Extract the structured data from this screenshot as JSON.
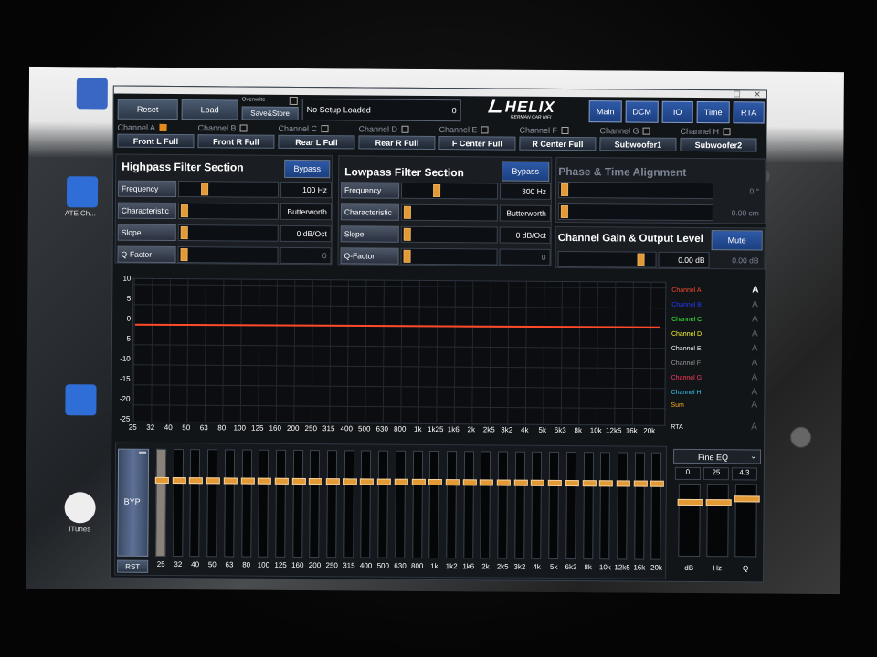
{
  "toolbar": {
    "reset_label": "Reset",
    "load_label": "Load",
    "overwrite_label": "Overwrite",
    "save_label": "Save&Store",
    "setup_status": "No Setup Loaded",
    "setup_count": "0",
    "brand": "HELIX",
    "brand_sub": "GERMAN CAR HIFI",
    "tabs": [
      "Main",
      "DCM",
      "IO",
      "Time",
      "RTA"
    ]
  },
  "channels": [
    {
      "name": "Channel A",
      "assign": "Front L Full",
      "checked": true
    },
    {
      "name": "Channel B",
      "assign": "Front R Full",
      "checked": false
    },
    {
      "name": "Channel C",
      "assign": "Rear L Full",
      "checked": false
    },
    {
      "name": "Channel D",
      "assign": "Rear R Full",
      "checked": false
    },
    {
      "name": "Channel E",
      "assign": "F Center Full",
      "checked": false
    },
    {
      "name": "Channel F",
      "assign": "R Center Full",
      "checked": false
    },
    {
      "name": "Channel G",
      "assign": "Subwoofer1",
      "checked": false
    },
    {
      "name": "Channel H",
      "assign": "Subwoofer2",
      "checked": false
    }
  ],
  "highpass": {
    "title": "Highpass Filter Section",
    "bypass_label": "Bypass",
    "rows": [
      {
        "label": "Frequency",
        "value": "100 Hz"
      },
      {
        "label": "Characteristic",
        "value": "Butterworth"
      },
      {
        "label": "Slope",
        "value": "0 dB/Oct"
      },
      {
        "label": "Q-Factor",
        "value": "0"
      }
    ]
  },
  "lowpass": {
    "title": "Lowpass Filter Section",
    "bypass_label": "Bypass",
    "rows": [
      {
        "label": "Frequency",
        "value": "300 Hz"
      },
      {
        "label": "Characteristic",
        "value": "Butterworth"
      },
      {
        "label": "Slope",
        "value": "0 dB/Oct"
      },
      {
        "label": "Q-Factor",
        "value": "0"
      }
    ]
  },
  "phase": {
    "title": "Phase & Time Alignment",
    "phase_value": "0 °",
    "time_value": "0.00 cm"
  },
  "gain": {
    "title": "Channel Gain & Output Level",
    "mute_label": "Mute",
    "gain_value": "0.00 dB",
    "output_value": "0.00 dB"
  },
  "graph": {
    "y_ticks": [
      "10",
      "5",
      "0",
      "-5",
      "-10",
      "-15",
      "-20",
      "-25"
    ],
    "x_ticks": [
      "25",
      "32",
      "40",
      "50",
      "63",
      "80",
      "100",
      "125",
      "160",
      "200",
      "250",
      "315",
      "400",
      "500",
      "630",
      "800",
      "1k",
      "1k25",
      "1k6",
      "2k",
      "2k5",
      "3k2",
      "4k",
      "5k",
      "6k3",
      "8k",
      "10k",
      "12k5",
      "16k",
      "20k"
    ],
    "curve_color": "#ff4a2a"
  },
  "legend": [
    {
      "label": "Channel A",
      "color": "#ff4a2a"
    },
    {
      "label": "Channel B",
      "color": "#1f3dff"
    },
    {
      "label": "Channel C",
      "color": "#39ff39"
    },
    {
      "label": "Channel D",
      "color": "#ffff33"
    },
    {
      "label": "Channel E",
      "color": "#ffffff"
    },
    {
      "label": "Channel F",
      "color": "#9a9a9a"
    },
    {
      "label": "Channel G",
      "color": "#ff3b5c"
    },
    {
      "label": "Channel H",
      "color": "#33ccff"
    },
    {
      "label": "Sum",
      "color": "#ffb020"
    },
    {
      "label": "RTA",
      "color": "#ffffff"
    }
  ],
  "eq": {
    "byp_label": "BYP",
    "rst_label": "RST",
    "bands": [
      "25",
      "32",
      "40",
      "50",
      "63",
      "80",
      "100",
      "125",
      "160",
      "200",
      "250",
      "315",
      "400",
      "500",
      "630",
      "800",
      "1k",
      "1k2",
      "1k6",
      "2k",
      "2k5",
      "3k2",
      "4k",
      "5k",
      "6k3",
      "8k",
      "10k",
      "12k5",
      "16k",
      "20k"
    ],
    "mode_label": "Fine EQ",
    "fine_values": [
      "0",
      "25",
      "4.3"
    ],
    "fine_axes": [
      "dB",
      "Hz",
      "Q"
    ]
  },
  "desktop": {
    "icon_label_1": "ATE Ch...",
    "icon_label_itunes": "iTunes"
  }
}
